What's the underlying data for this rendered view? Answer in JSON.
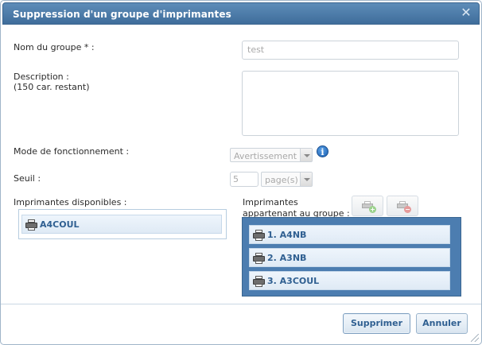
{
  "dialog": {
    "title": "Suppression d'un groupe d'imprimantes",
    "close_icon": "close-icon"
  },
  "form": {
    "group_name_label": "Nom du groupe * :",
    "group_name_value": "test",
    "description_label": "Description :",
    "description_hint": "(150 car. restant)",
    "description_value": "",
    "mode_label": "Mode de fonctionnement :",
    "mode_value": "Avertissement",
    "threshold_label": "Seuil :",
    "threshold_value": "5",
    "threshold_unit": "page(s)"
  },
  "available": {
    "label": "Imprimantes disponibles :",
    "items": [
      "A4COUL"
    ]
  },
  "members": {
    "label_line1": "Imprimantes",
    "label_line2": "appartenant au groupe :",
    "items": [
      "1. A4NB",
      "2. A3NB",
      "3. A3COUL"
    ]
  },
  "buttons": {
    "delete": "Supprimer",
    "cancel": "Annuler"
  },
  "colors": {
    "titlebar": "#4a79a8",
    "accent_text": "#2f5f91",
    "member_list_bg": "#4c7db0"
  }
}
